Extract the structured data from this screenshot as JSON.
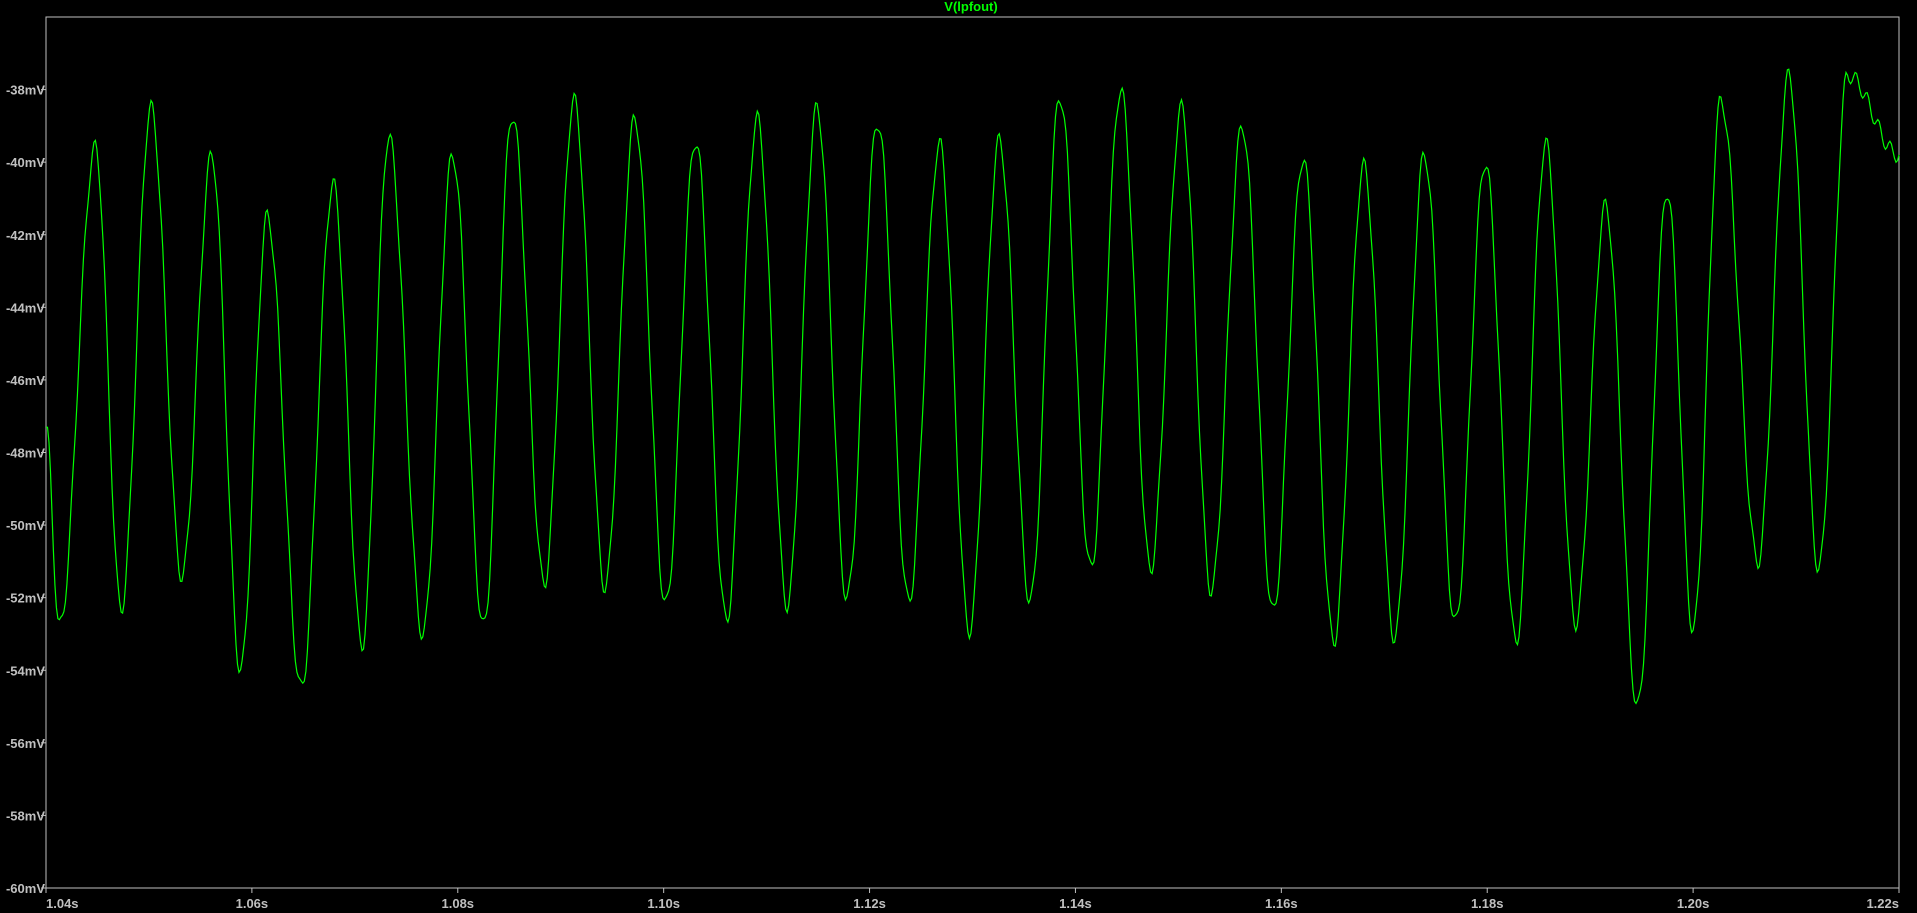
{
  "chart_data": {
    "type": "line",
    "title": "V(lpfout)",
    "xlabel": "",
    "ylabel": "",
    "xlim": [
      1.04,
      1.22
    ],
    "ylim": [
      -60,
      -36.0
    ],
    "x_ticks": [
      "1.04s",
      "1.06s",
      "1.08s",
      "1.10s",
      "1.12s",
      "1.14s",
      "1.16s",
      "1.18s",
      "1.20s",
      "1.22s"
    ],
    "x_tick_values": [
      1.04,
      1.06,
      1.08,
      1.1,
      1.12,
      1.14,
      1.16,
      1.18,
      1.2,
      1.22
    ],
    "y_ticks": [
      "-38mV",
      "-40mV",
      "-42mV",
      "-44mV",
      "-46mV",
      "-48mV",
      "-50mV",
      "-52mV",
      "-54mV",
      "-56mV",
      "-58mV",
      "-60mV"
    ],
    "y_tick_values": [
      -38,
      -40,
      -42,
      -44,
      -46,
      -48,
      -50,
      -52,
      -54,
      -56,
      -58,
      -60
    ],
    "grid": false,
    "background": "#000000",
    "trace_color": "#00ff00",
    "axis_color": "#c0c0c0",
    "series": [
      {
        "name": "V(lpfout)",
        "x": [
          1.04,
          1.0413,
          1.0448,
          1.0473,
          1.0502,
          1.0532,
          1.0561,
          1.0589,
          1.0615,
          1.0648,
          1.0679,
          1.0707,
          1.0733,
          1.0766,
          1.0795,
          1.0825,
          1.0853,
          1.0884,
          1.0913,
          1.0943,
          1.0972,
          1.1002,
          1.1031,
          1.1061,
          1.1091,
          1.112,
          1.1149,
          1.1178,
          1.1208,
          1.1238,
          1.1268,
          1.1297,
          1.1326,
          1.1356,
          1.1385,
          1.1415,
          1.1444,
          1.1473,
          1.1503,
          1.1532,
          1.1562,
          1.1592,
          1.1621,
          1.1651,
          1.168,
          1.171,
          1.1739,
          1.1769,
          1.1798,
          1.1828,
          1.1857,
          1.1886,
          1.1915,
          1.1946,
          1.1975,
          1.2,
          1.2027,
          1.2063,
          1.2093,
          1.2122,
          1.215,
          1.22
        ],
        "y": [
          -47.3,
          -52.8,
          -39.6,
          -52.3,
          -38.5,
          -51.4,
          -39.8,
          -54.0,
          -41.5,
          -54.5,
          -40.6,
          -53.3,
          -39.3,
          -53.0,
          -39.8,
          -52.8,
          -38.7,
          -51.6,
          -38.3,
          -51.7,
          -38.8,
          -52.2,
          -39.4,
          -52.6,
          -38.8,
          -52.2,
          -38.5,
          -52.0,
          -38.9,
          -52.1,
          -39.5,
          -52.9,
          -39.4,
          -52.1,
          -38.2,
          -51.2,
          -38.0,
          -51.2,
          -38.5,
          -51.8,
          -39.0,
          -52.4,
          -39.9,
          -53.2,
          -40.1,
          -53.1,
          -39.8,
          -52.7,
          -40.0,
          -53.2,
          -39.5,
          -52.7,
          -41.2,
          -55.0,
          -40.8,
          -52.9,
          -38.3,
          -51.0,
          -37.6,
          -51.2,
          -37.6,
          -39.8
        ]
      }
    ]
  }
}
